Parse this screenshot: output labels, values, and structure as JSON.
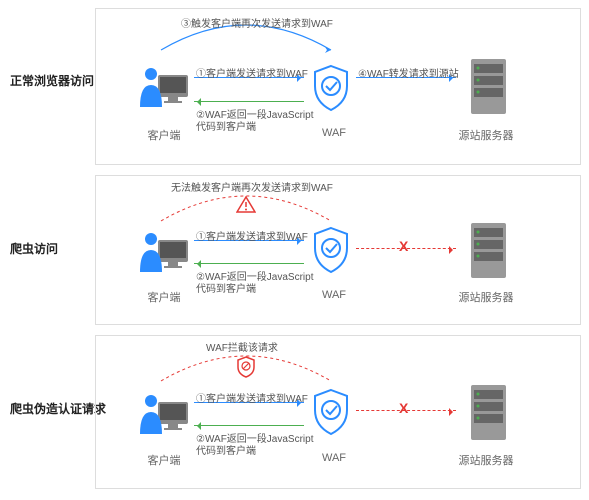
{
  "titles": {
    "normal": "正常浏览器访问",
    "crawler": "爬虫访问",
    "fake": "爬虫伪造认证请求"
  },
  "labels": {
    "client": "客户端",
    "waf": "WAF",
    "server": "源站服务器"
  },
  "section1": {
    "curve": "③触发客户端再次发送请求到WAF",
    "step1": "①客户端发送请求到WAF",
    "step2a": "②WAF返回一段JavaScript",
    "step2b": "代码到客户端",
    "step4": "④WAF转发请求到源站"
  },
  "section2": {
    "curve": "无法触发客户端再次发送请求到WAF",
    "step1": "①客户端发送请求到WAF",
    "step2a": "②WAF返回一段JavaScript",
    "step2b": "代码到客户端",
    "x": "X"
  },
  "section3": {
    "curve": "WAF拦截该请求",
    "step1": "①客户端发送请求到WAF",
    "step2a": "②WAF返回一段JavaScript",
    "step2b": "代码到客户端",
    "x": "X"
  }
}
